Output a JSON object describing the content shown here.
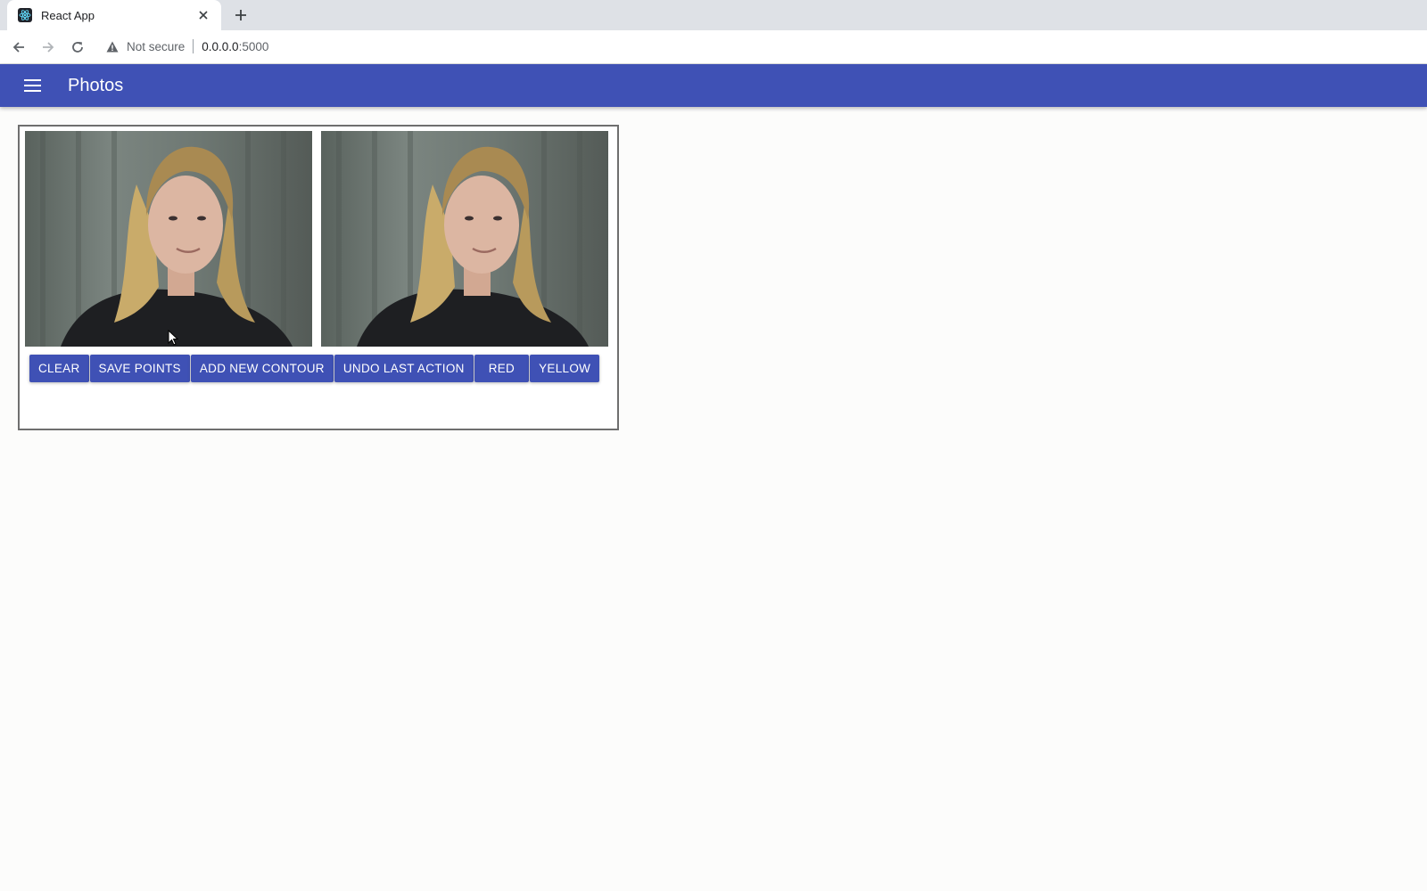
{
  "browser": {
    "tab_title": "React App",
    "security_label": "Not secure",
    "url_host": "0.0.0.0",
    "url_port": ":5000"
  },
  "appbar": {
    "title": "Photos",
    "color": "#3f51b5"
  },
  "photos": [
    {
      "id": "left",
      "description_icon": "webcam-photo"
    },
    {
      "id": "right",
      "description_icon": "webcam-photo"
    }
  ],
  "buttons": {
    "clear": "CLEAR",
    "save_points": "SAVE POINTS",
    "add_new_contour": "ADD NEW CONTOUR",
    "undo_last_action": "UNDO LAST ACTION",
    "red": "RED",
    "yellow": "YELLOW"
  },
  "icons": {
    "favicon": "react-icon",
    "close": "close-icon",
    "new_tab": "plus-icon",
    "back": "arrow-left-icon",
    "forward": "arrow-right-icon",
    "reload": "reload-icon",
    "warning": "warning-icon",
    "menu": "hamburger-menu-icon"
  }
}
